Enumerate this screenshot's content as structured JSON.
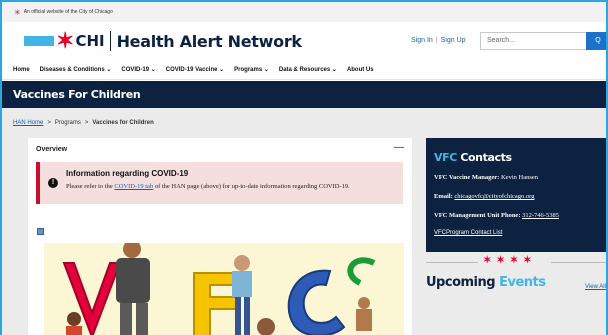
{
  "official_bar": {
    "icon": "city-star-icon",
    "text": "An official website of the City of Chicago"
  },
  "header": {
    "logo_chi": "CHI",
    "logo_title": "Health Alert Network",
    "sign_in": "Sign In",
    "separator": "|",
    "sign_up": "Sign Up",
    "search_placeholder": "Search...",
    "search_button": "Q"
  },
  "nav": {
    "items": [
      {
        "label": "Home"
      },
      {
        "label": "Diseases & Conditions ⌄"
      },
      {
        "label": "COVID-19 ⌄"
      },
      {
        "label": "COVID-19 Vaccine ⌄"
      },
      {
        "label": "Programs ⌄"
      },
      {
        "label": "Data & Resources ⌄"
      },
      {
        "label": "About Us"
      }
    ]
  },
  "page_banner": "Vaccines For Children",
  "breadcrumb": {
    "home": "HAN Home",
    "sep": ">",
    "programs": "Programs",
    "current": "Vaccines for Children"
  },
  "overview": {
    "title": "Overview",
    "collapse": "—",
    "alert_title": "Information regarding COVID-19",
    "alert_pre": "Please refer to the ",
    "alert_link": "COVID-19 tab",
    "alert_post": " of the HAN page (above) for up-to-date information regarding COVID-19."
  },
  "vfc_contacts": {
    "title_main": "VFC",
    "title_sub": " Contacts",
    "manager_label": "VFC Vaccine Manager: ",
    "manager_name": "Kevin Hansen",
    "email_label": "Email: ",
    "email": "chicagovfc@cityofchicago.org",
    "phone_label": "VFC Management Unit Phone: ",
    "phone": "312-746-5385",
    "contact_list": "VFCProgram Contact List"
  },
  "stars": "✶✶✶✶",
  "events": {
    "title_main": "Upcoming",
    "title_sub": " Events",
    "view_all": "View All"
  },
  "colors": {
    "navy": "#0d2240",
    "chicago_blue": "#41b6e6",
    "chicago_red": "#e4002b",
    "link_blue": "#1a5ea8"
  }
}
